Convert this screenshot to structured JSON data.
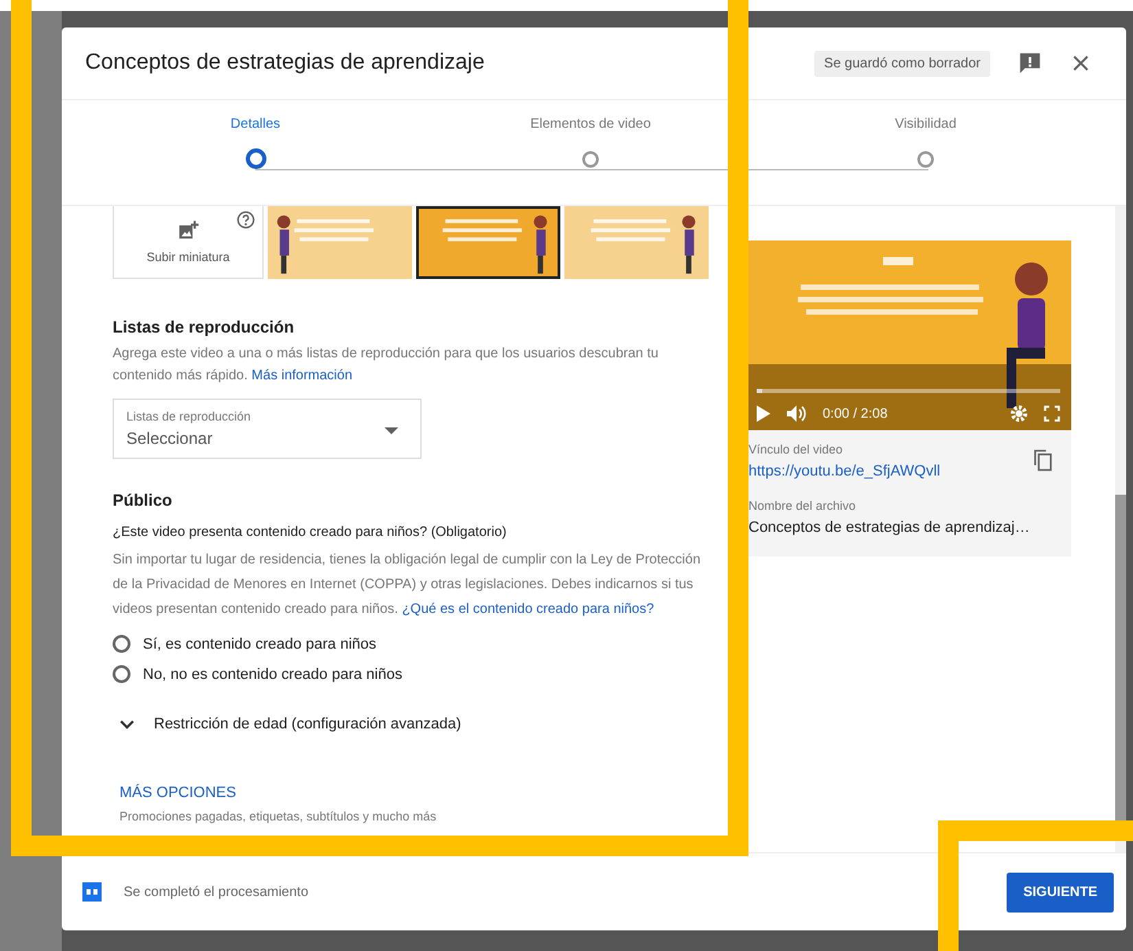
{
  "window": {
    "title": "Conceptos de estrategias de aprendizaje",
    "draft_badge": "Se guardó como borrador"
  },
  "steps": [
    {
      "label": "Detalles",
      "selected": true
    },
    {
      "label": "Elementos de video",
      "selected": false
    },
    {
      "label": "Visibilidad",
      "selected": false
    }
  ],
  "thumbnails": {
    "upload_label": "Subir miniatura",
    "items": [
      {
        "kind": "picture",
        "selected": false
      },
      {
        "kind": "picture",
        "selected": true
      },
      {
        "kind": "picture",
        "selected": false
      }
    ]
  },
  "playlists": {
    "heading": "Listas de reproducción",
    "description": "Agrega este video a una o más listas de reproducción para que los usuarios descubran tu contenido más rápido.",
    "link": "Más información",
    "field": {
      "label": "Listas de reproducción",
      "value": "Seleccionar"
    }
  },
  "audience": {
    "heading": "Público",
    "question": "¿Este video presenta contenido creado para niños? (Obligatorio)",
    "description": "Sin importar tu lugar de residencia, tienes la obligación legal de cumplir con la Ley de Protección de la Privacidad de Menores en Internet (COPPA) y otras legislaciones. Debes indicarnos si tus videos presentan contenido creado para niños.",
    "link": "¿Qué es el contenido creado para niños?",
    "options": [
      {
        "label": "Sí, es contenido creado para niños",
        "checked": false
      },
      {
        "label": "No, no es contenido creado para niños",
        "checked": false
      }
    ]
  },
  "age_restriction": {
    "label": "Restricción de edad (configuración avanzada)",
    "expanded": false
  },
  "more_options": {
    "label": "MÁS OPCIONES",
    "description": "Promociones pagadas, etiquetas, subtítulos y mucho más"
  },
  "video": {
    "progress": {
      "level": 0.02
    },
    "time": "0:00 / 2:08",
    "link_label": "Vínculo del video",
    "link": "https://youtu.be/e_SfjAWQvll",
    "filename_label": "Nombre del archivo",
    "filename": "Conceptos de estrategias de aprendizaj…"
  },
  "footer": {
    "status": "Se completó el procesamiento",
    "button": "SIGUIENTE"
  }
}
